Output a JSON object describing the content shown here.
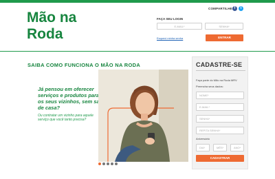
{
  "logo": {
    "line1": "Mão na",
    "line2": "Roda"
  },
  "header": {
    "share_label": "COMPARTILHE:",
    "facebook_glyph": "f",
    "twitter_glyph": "t",
    "login_title": "FAÇA SEU LOGIN",
    "email_placeholder": "E-MAIL*",
    "password_placeholder": "SENHA*",
    "forgot_link": "Esqueci minha senha",
    "login_button": "ENTRAR"
  },
  "main": {
    "section_title": "SAIBA COMO FUNCIONA O MÃO NA RODA",
    "promo_question": "Já pensou em oferecer serviços e produtos para os seus vizinhos, sem sair de casa?",
    "promo_sub": "Ou contratar um vizinho para aquele serviço que você tanto precisa?",
    "carousel_dots": 5,
    "carousel_active_index": 0
  },
  "signup": {
    "title": "CADASTRE-SE",
    "intro": "Faça parte do Mão na Roda MRV",
    "fill_label": "Preencha seus dados:",
    "name_placeholder": "NOME*",
    "email_placeholder": "E-MAIL*",
    "password_placeholder": "SENHA*",
    "repeat_password_placeholder": "REPITA SENHA*",
    "birthday_label": "Aniversário",
    "day_placeholder": "DIA*",
    "month_placeholder": "MÊS*",
    "year_placeholder": "ANO*",
    "submit_button": "CADASTRAR"
  },
  "colors": {
    "brand_green": "#17853f",
    "accent_orange": "#ee6a32"
  }
}
